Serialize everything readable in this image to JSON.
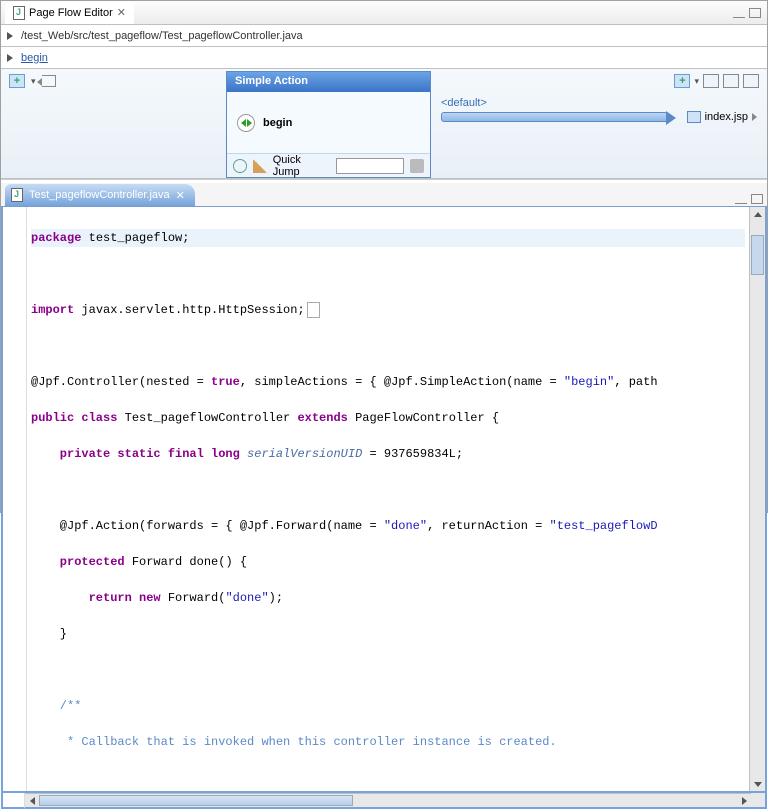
{
  "pageFlowEditor": {
    "title": "Page Flow Editor",
    "breadcrumbPath": "/test_Web/src/test_pageflow/Test_pageflowController.java",
    "breadcrumbAction": "begin",
    "simpleAction": {
      "header": "Simple Action",
      "name": "begin",
      "quickJumpLabel": "Quick Jump",
      "quickJumpValue": ""
    },
    "forward": {
      "label": "<default>",
      "target": "index.jsp"
    }
  },
  "editor": {
    "tabFile": "Test_pageflowController.java",
    "code": {
      "l1_pkg": "package",
      "l1_rest": " test_pageflow;",
      "l3_imp": "import",
      "l3_rest": " javax.servlet.http.HttpSession;",
      "l5a": "@Jpf.Controller(nested = ",
      "l5_true": "true",
      "l5b": ", simpleActions = { @Jpf.SimpleAction(name = ",
      "l5_s1": "\"begin\"",
      "l5c": ", path",
      "l6a": "public class",
      "l6b": " Test_pageflowController ",
      "l6c": "extends",
      "l6d": " PageFlowController {",
      "l7a": "    private static final long",
      "l7_field": " serialVersionUID",
      "l7b": " = 937659834L;",
      "l9a": "    @Jpf.Action(forwards = { @Jpf.Forward(name = ",
      "l9_s1": "\"done\"",
      "l9b": ", returnAction = ",
      "l9_s2": "\"test_pageflowD",
      "l10a": "    protected",
      "l10b": " Forward done() {",
      "l11a": "        return new",
      "l11b": " Forward(",
      "l11_s1": "\"done\"",
      "l11c": ");",
      "l12": "    }",
      "l14": "    /**",
      "l15": "     * Callback that is invoked when this controller instance is created."
    }
  }
}
